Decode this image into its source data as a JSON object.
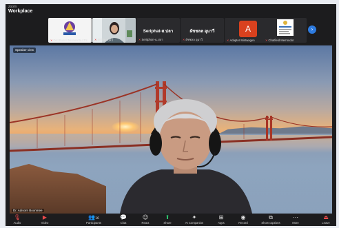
{
  "window": {
    "app_small": "zoom",
    "title": "Workplace"
  },
  "strip": {
    "tiles": [
      {
        "label": "Dist.Bunnit Minnesota.LTS"
      },
      {
        "label": "Sirithp (ภูมิ )"
      },
      {
        "name": "Seriphat-ส.ปลา",
        "label": "Seritphon-ฉ.ปลา"
      },
      {
        "name": "ผัชชลล อุมาวี",
        "label": "ผัชชลล อุมาวี"
      },
      {
        "label": "Adapter Mintwagen"
      },
      {
        "label": "Chatfield Merrondor"
      }
    ],
    "next_icon": "chevron-right-icon"
  },
  "stage": {
    "pin_label": "Speaker view",
    "speaker_name": "Dr. Adisorn Boonmee"
  },
  "toolbar": {
    "buttons": [
      {
        "icon": "microphone-muted-icon",
        "label": "Audio"
      },
      {
        "icon": "video-muted-icon",
        "label": "Video"
      },
      {
        "icon": "participants-icon",
        "label": "Participants",
        "count": "16"
      },
      {
        "icon": "chat-icon",
        "label": "Chat"
      },
      {
        "icon": "react-icon",
        "label": "React"
      },
      {
        "icon": "share-screen-icon",
        "label": "Share"
      },
      {
        "icon": "ai-companion-icon",
        "label": "AI Companion"
      },
      {
        "icon": "apps-icon",
        "label": "Apps"
      },
      {
        "icon": "record-icon",
        "label": "Record"
      },
      {
        "icon": "show-captions-icon",
        "label": "Show captions"
      },
      {
        "icon": "more-icon",
        "label": "More"
      },
      {
        "icon": "leave-icon",
        "label": "Leave"
      }
    ]
  }
}
